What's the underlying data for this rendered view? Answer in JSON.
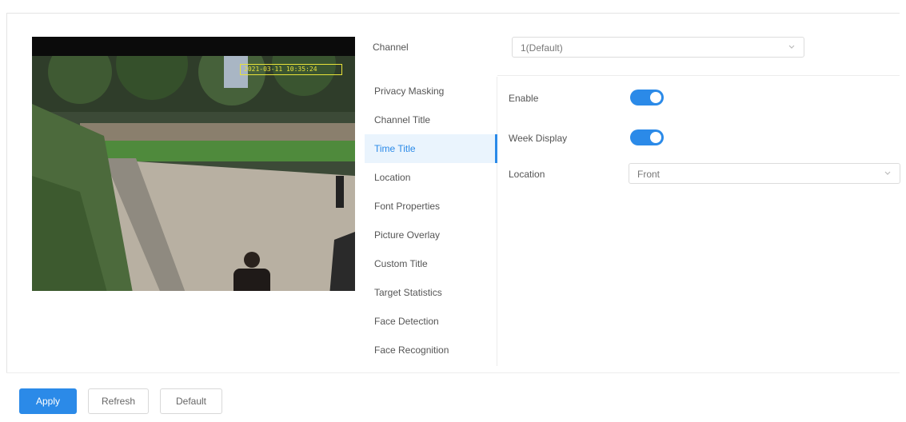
{
  "channel": {
    "label": "Channel",
    "value": "1(Default)"
  },
  "preview": {
    "osd_time": "2021-03-11 10:35:24"
  },
  "menu": {
    "items": [
      {
        "label": "Privacy Masking"
      },
      {
        "label": "Channel Title"
      },
      {
        "label": "Time Title"
      },
      {
        "label": "Location"
      },
      {
        "label": "Font Properties"
      },
      {
        "label": "Picture Overlay"
      },
      {
        "label": "Custom Title"
      },
      {
        "label": "Target Statistics"
      },
      {
        "label": "Face Detection"
      },
      {
        "label": "Face Recognition"
      }
    ],
    "active": "Time Title"
  },
  "settings": {
    "enable": {
      "label": "Enable",
      "on": true
    },
    "week_display": {
      "label": "Week Display",
      "on": true
    },
    "location": {
      "label": "Location",
      "value": "Front"
    }
  },
  "buttons": {
    "apply": "Apply",
    "refresh": "Refresh",
    "default": "Default"
  },
  "colors": {
    "accent": "#2b8ae8",
    "active_bg": "#eaf4fd",
    "osd": "#e8e23a"
  }
}
